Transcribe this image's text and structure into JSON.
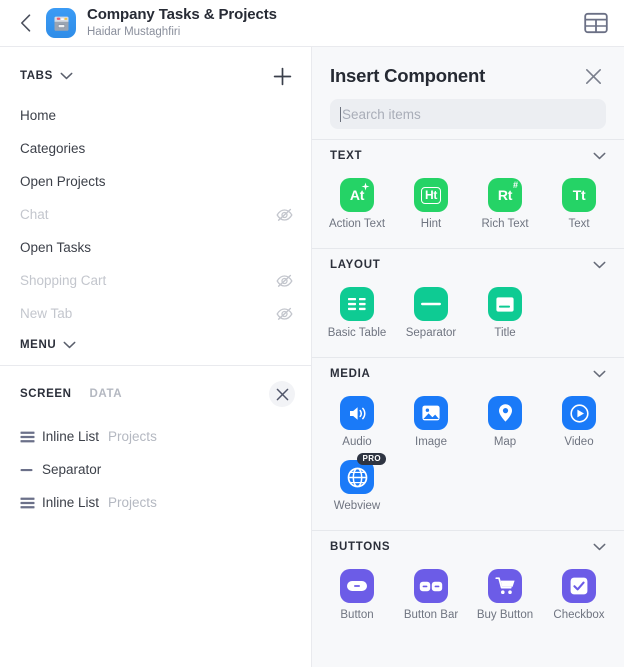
{
  "topbar": {
    "back_icon": "chevron-left-icon",
    "app_icon": "file-box-icon",
    "title": "Company Tasks & Projects",
    "subtitle": "Haidar Mustaghfiri",
    "grid_icon": "table-layout-icon"
  },
  "sidebar": {
    "tabs_section": {
      "label": "TABS",
      "caret_icon": "chevron-down-icon",
      "add_icon": "plus-icon",
      "items": [
        {
          "label": "Home",
          "hidden": false
        },
        {
          "label": "Categories",
          "hidden": false
        },
        {
          "label": "Open Projects",
          "hidden": false
        },
        {
          "label": "Chat",
          "hidden": true
        },
        {
          "label": "Open Tasks",
          "hidden": false
        },
        {
          "label": "Shopping Cart",
          "hidden": true
        },
        {
          "label": "New Tab",
          "hidden": true
        }
      ],
      "hidden_icon": "eye-off-icon"
    },
    "menu_section": {
      "label": "MENU",
      "caret_icon": "chevron-down-icon"
    },
    "screen_panel": {
      "tab_screen": "SCREEN",
      "tab_data": "DATA",
      "close_icon": "close-icon",
      "components": [
        {
          "icon": "list-icon",
          "name": "Inline List",
          "meta": "Projects"
        },
        {
          "icon": "separator-icon",
          "name": "Separator",
          "meta": ""
        },
        {
          "icon": "list-icon",
          "name": "Inline List",
          "meta": "Projects"
        }
      ]
    }
  },
  "insert_panel": {
    "title": "Insert Component",
    "close_icon": "close-icon",
    "search": {
      "value": "",
      "placeholder": "Search items"
    },
    "groups": [
      {
        "label": "TEXT",
        "caret_icon": "chevron-down-icon",
        "color": "#25d366",
        "items": [
          {
            "label": "Action Text",
            "glyph": "At",
            "icon": "action-text-icon",
            "pro": false
          },
          {
            "label": "Hint",
            "glyph": "Ht",
            "icon": "hint-icon",
            "pro": false
          },
          {
            "label": "Rich Text",
            "glyph": "Rt",
            "icon": "rich-text-icon",
            "pro": false
          },
          {
            "label": "Text",
            "glyph": "Tt",
            "icon": "text-icon",
            "pro": false
          }
        ]
      },
      {
        "label": "LAYOUT",
        "caret_icon": "chevron-down-icon",
        "color": "#0ecb93",
        "items": [
          {
            "label": "Basic Table",
            "glyph": "",
            "icon": "basic-table-icon",
            "pro": false
          },
          {
            "label": "Separator",
            "glyph": "",
            "icon": "separator-icon",
            "pro": false
          },
          {
            "label": "Title",
            "glyph": "",
            "icon": "title-icon",
            "pro": false
          }
        ]
      },
      {
        "label": "MEDIA",
        "caret_icon": "chevron-down-icon",
        "color": "#1a7af8",
        "items": [
          {
            "label": "Audio",
            "glyph": "",
            "icon": "audio-icon",
            "pro": false
          },
          {
            "label": "Image",
            "glyph": "",
            "icon": "image-icon",
            "pro": false
          },
          {
            "label": "Map",
            "glyph": "",
            "icon": "map-pin-icon",
            "pro": false
          },
          {
            "label": "Video",
            "glyph": "",
            "icon": "video-play-icon",
            "pro": false
          },
          {
            "label": "Webview",
            "glyph": "",
            "icon": "globe-icon",
            "pro": true
          }
        ]
      },
      {
        "label": "BUTTONS",
        "caret_icon": "chevron-down-icon",
        "color": "#6c5ce7",
        "items": [
          {
            "label": "Button",
            "glyph": "",
            "icon": "button-icon",
            "pro": false
          },
          {
            "label": "Button Bar",
            "glyph": "",
            "icon": "button-bar-icon",
            "pro": false
          },
          {
            "label": "Buy Button",
            "glyph": "",
            "icon": "shopping-cart-icon",
            "pro": false
          },
          {
            "label": "Checkbox",
            "glyph": "",
            "icon": "checkbox-icon",
            "pro": false
          }
        ]
      }
    ],
    "pro_badge_label": "PRO"
  }
}
